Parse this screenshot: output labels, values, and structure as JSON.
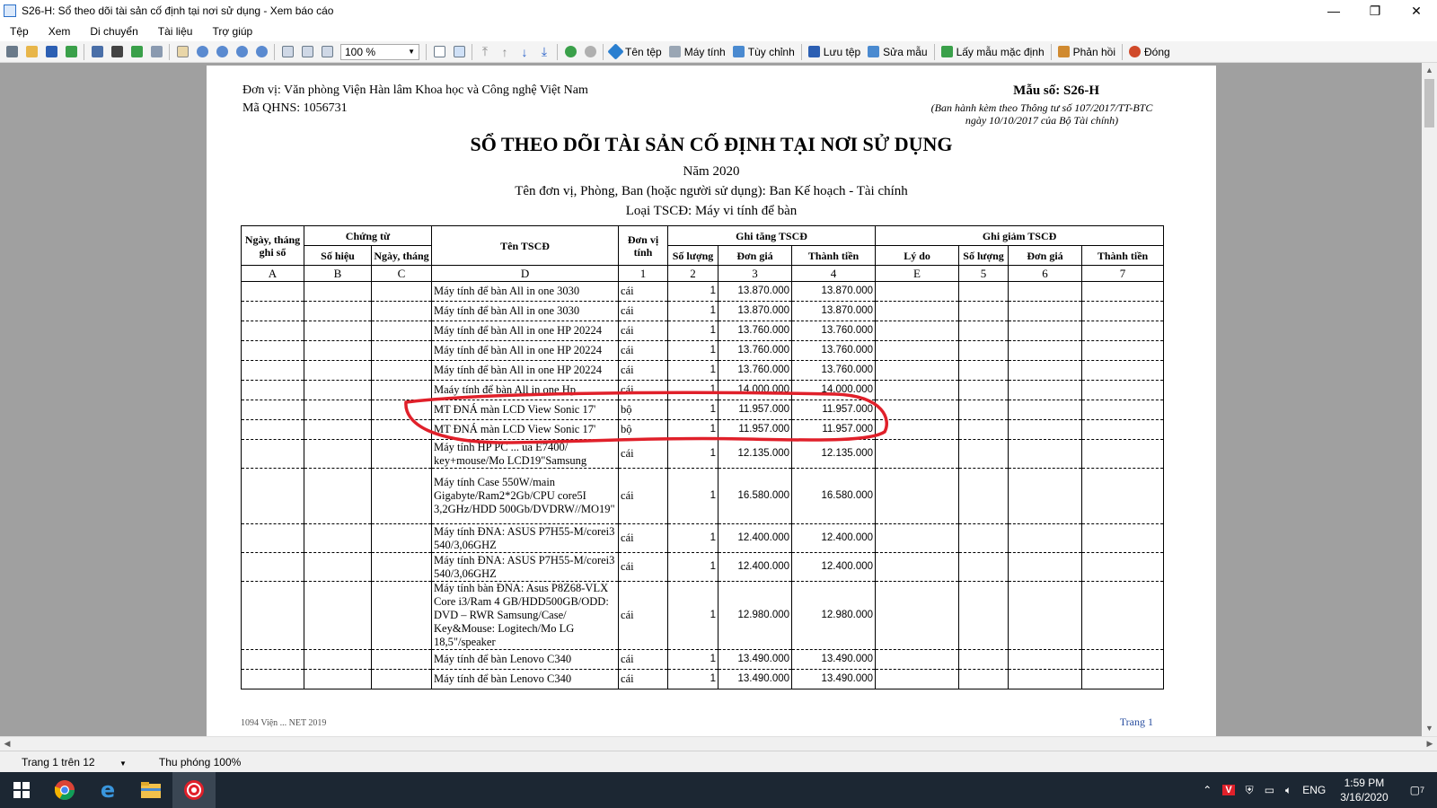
{
  "window": {
    "title": "S26-H: Sổ theo dõi tài sản cố định tại nơi sử dụng - Xem báo cáo",
    "min": "—",
    "max": "❐",
    "close": "✕"
  },
  "menu": [
    "Tệp",
    "Xem",
    "Di chuyển",
    "Tài liệu",
    "Trợ giúp"
  ],
  "toolbar": {
    "zoom": "100 %",
    "buttons": [
      {
        "label": "Tên tệp"
      },
      {
        "label": "Máy tính"
      },
      {
        "label": "Tùy chỉnh"
      },
      {
        "label": "Lưu tệp"
      },
      {
        "label": "Sửa mẫu"
      },
      {
        "label": "Lấy mẫu mặc định"
      },
      {
        "label": "Phản hồi"
      },
      {
        "label": "Đóng"
      }
    ]
  },
  "report": {
    "unit": "Đơn vị: Văn phòng Viện Hàn lâm Khoa học và Công nghệ Việt Nam",
    "qhns": "Mã QHNS: 1056731",
    "form_no": "Mẫu số: S26-H",
    "issued_line1": "(Ban hành kèm theo Thông tư số 107/2017/TT-BTC",
    "issued_line2": "ngày 10/10/2017 của Bộ Tài chính)",
    "title": "SỔ THEO DÕI TÀI SẢN CỐ ĐỊNH TẠI NƠI SỬ DỤNG",
    "year": "Năm 2020",
    "department": "Tên đơn vị, Phòng, Ban (hoặc người sử dụng): Ban Kế hoạch - Tài chính",
    "asset_type": "Loại TSCĐ: Máy vi tính để bàn",
    "headers": {
      "date": "Ngày, tháng ghi sổ",
      "voucher": "Chứng từ",
      "voucher_no": "Số hiệu",
      "voucher_date": "Ngày, tháng",
      "name": "Tên TSCĐ",
      "unit": "Đơn vị tính",
      "increase": "Ghi tăng TSCĐ",
      "inc_qty": "Số lượng",
      "inc_price": "Đơn giá",
      "inc_amount": "Thành tiền",
      "decrease": "Ghi giảm TSCĐ",
      "dec_reason": "Lý do",
      "dec_qty": "Số lượng",
      "dec_price": "Đơn giá",
      "dec_amount": "Thành tiền"
    },
    "col_labels": [
      "A",
      "B",
      "C",
      "D",
      "1",
      "2",
      "3",
      "4",
      "E",
      "5",
      "6",
      "7"
    ],
    "rows": [
      {
        "name": "Máy tính để bàn All in one 3030",
        "unit": "cái",
        "qty": "1",
        "price": "13.870.000",
        "amount": "13.870.000"
      },
      {
        "name": "Máy tính để bàn All in one 3030",
        "unit": "cái",
        "qty": "1",
        "price": "13.870.000",
        "amount": "13.870.000"
      },
      {
        "name": "Máy tính để bàn All in one HP 20224",
        "unit": "cái",
        "qty": "1",
        "price": "13.760.000",
        "amount": "13.760.000"
      },
      {
        "name": "Máy tính để bàn All in one HP 20224",
        "unit": "cái",
        "qty": "1",
        "price": "13.760.000",
        "amount": "13.760.000"
      },
      {
        "name": "Máy tính để bàn All in one HP 20224",
        "unit": "cái",
        "qty": "1",
        "price": "13.760.000",
        "amount": "13.760.000"
      },
      {
        "name": "Maáy tính để bàn All in one Hp",
        "unit": "cái",
        "qty": "1",
        "price": "14.000.000",
        "amount": "14.000.000"
      },
      {
        "name": "MT ĐNÁ màn LCD View Sonic 17'",
        "unit": "bộ",
        "qty": "1",
        "price": "11.957.000",
        "amount": "11.957.000"
      },
      {
        "name": "MT ĐNÁ màn LCD View Sonic 17'",
        "unit": "bộ",
        "qty": "1",
        "price": "11.957.000",
        "amount": "11.957.000"
      },
      {
        "name": "Máy tính HP PC ... ua E7400/ key+mouse/Mo LCD19\"Samsung",
        "unit": "cái",
        "qty": "1",
        "price": "12.135.000",
        "amount": "12.135.000"
      },
      {
        "name": "Máy tính Case 550W/main Gigabyte/Ram2*2Gb/CPU core5I 3,2GHz/HDD 500Gb/DVDRW//MO19\"",
        "unit": "cái",
        "qty": "1",
        "price": "16.580.000",
        "amount": "16.580.000"
      },
      {
        "name": "Máy tính ĐNA: ASUS P7H55-M/corei3 540/3,06GHZ",
        "unit": "cái",
        "qty": "1",
        "price": "12.400.000",
        "amount": "12.400.000"
      },
      {
        "name": "Máy tính ĐNA: ASUS P7H55-M/corei3 540/3,06GHZ",
        "unit": "cái",
        "qty": "1",
        "price": "12.400.000",
        "amount": "12.400.000"
      },
      {
        "name": "Máy tính bàn ĐNA: Asus P8Z68-VLX Core i3/Ram 4 GB/HDD500GB/ODD: DVD – RWR Samsung/Case/ Key&Mouse: Logitech/Mo LG 18,5\"/speaker",
        "unit": "cái",
        "qty": "1",
        "price": "12.980.000",
        "amount": "12.980.000"
      },
      {
        "name": "Máy tính để bàn Lenovo C340",
        "unit": "cái",
        "qty": "1",
        "price": "13.490.000",
        "amount": "13.490.000"
      },
      {
        "name": "Máy tính để bàn Lenovo C340",
        "unit": "cái",
        "qty": "1",
        "price": "13.490.000",
        "amount": "13.490.000"
      }
    ],
    "footer_left": "1094 Viện ... NET 2019",
    "footer_right": "Trang 1"
  },
  "status": {
    "page": "Trang 1 trên 12",
    "zoom": "Thu phóng 100%"
  },
  "tray": {
    "lang": "ENG",
    "time": "1:59 PM",
    "date": "3/16/2020",
    "notif": "7"
  },
  "colors": {
    "annotation": "#e0202a",
    "viewer_bg": "#a0a0a0",
    "taskbar": "#1c2733"
  }
}
